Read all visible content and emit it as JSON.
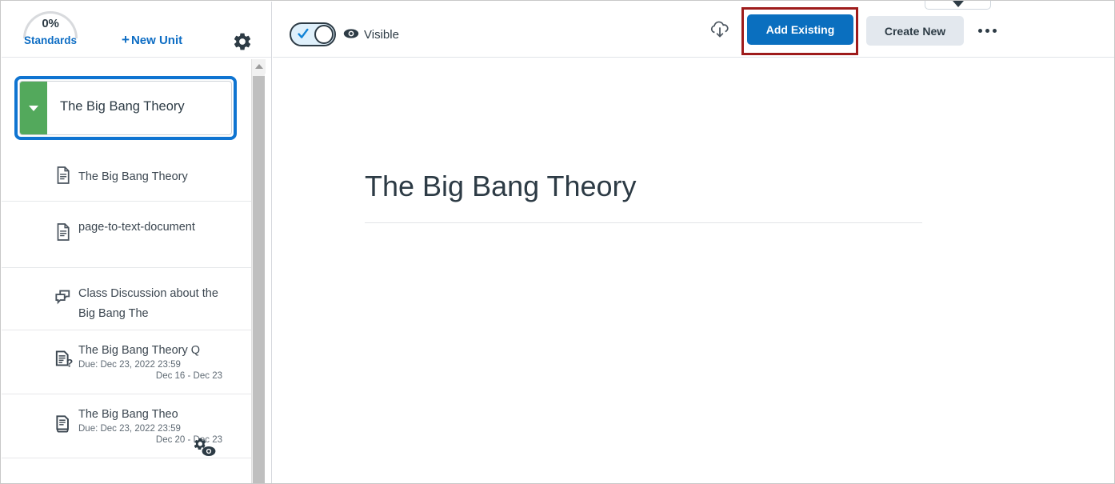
{
  "sidebar": {
    "standards": {
      "percent": "0%",
      "label": "Standards",
      "icon": "gauge-icon"
    },
    "new_unit_label": "New Unit",
    "new_unit_plus": "+",
    "settings_icon": "gear-icon",
    "unit": {
      "title": "The Big Bang Theory",
      "caret_icon": "caret-down-icon",
      "selected": true
    },
    "scrollbar": {
      "up_icon": "scroll-up-arrow-icon"
    },
    "items": [
      {
        "title": "The Big Bang Theory",
        "icon": "page-document-icon",
        "due": "",
        "range": ""
      },
      {
        "title": "page-to-text-document",
        "icon": "page-document-icon",
        "due": "",
        "range": ""
      },
      {
        "title": "Class Discussion about the Big Bang The",
        "icon": "discussion-icon",
        "due": "",
        "range": ""
      },
      {
        "title": "The Big Bang Theory Q",
        "icon": "quiz-document-icon",
        "due": "Due: Dec 23, 2022 23:59",
        "range": "Dec 16 - Dec 23"
      },
      {
        "title": "The Big Bang Theo",
        "icon": "assignment-document-icon",
        "due": "Due: Dec 23, 2022 23:59",
        "range": "Dec 20 - Dec 23",
        "badge_icon": "gear-eye-icon"
      }
    ]
  },
  "toolbar": {
    "toggle": {
      "state": "on",
      "check_icon": "check-icon"
    },
    "visibility_icon": "eye-icon",
    "visibility_label": "Visible",
    "cloud_icon": "cloud-download-icon",
    "add_existing_label": "Add Existing",
    "create_new_label": "Create New",
    "more_icon": "ellipsis-icon",
    "top_dropdown_icon": "chevron-down-icon"
  },
  "main": {
    "title": "The Big Bang Theory"
  },
  "colors": {
    "primary_blue": "#0a6fbf",
    "link_blue": "#0d6dc4",
    "unit_green": "#53a95c",
    "focus_ring": "#0f74d1",
    "highlight_red": "#9e1b1b",
    "secondary_button": "#e3e8ee",
    "text_dark": "#2d3b45"
  }
}
